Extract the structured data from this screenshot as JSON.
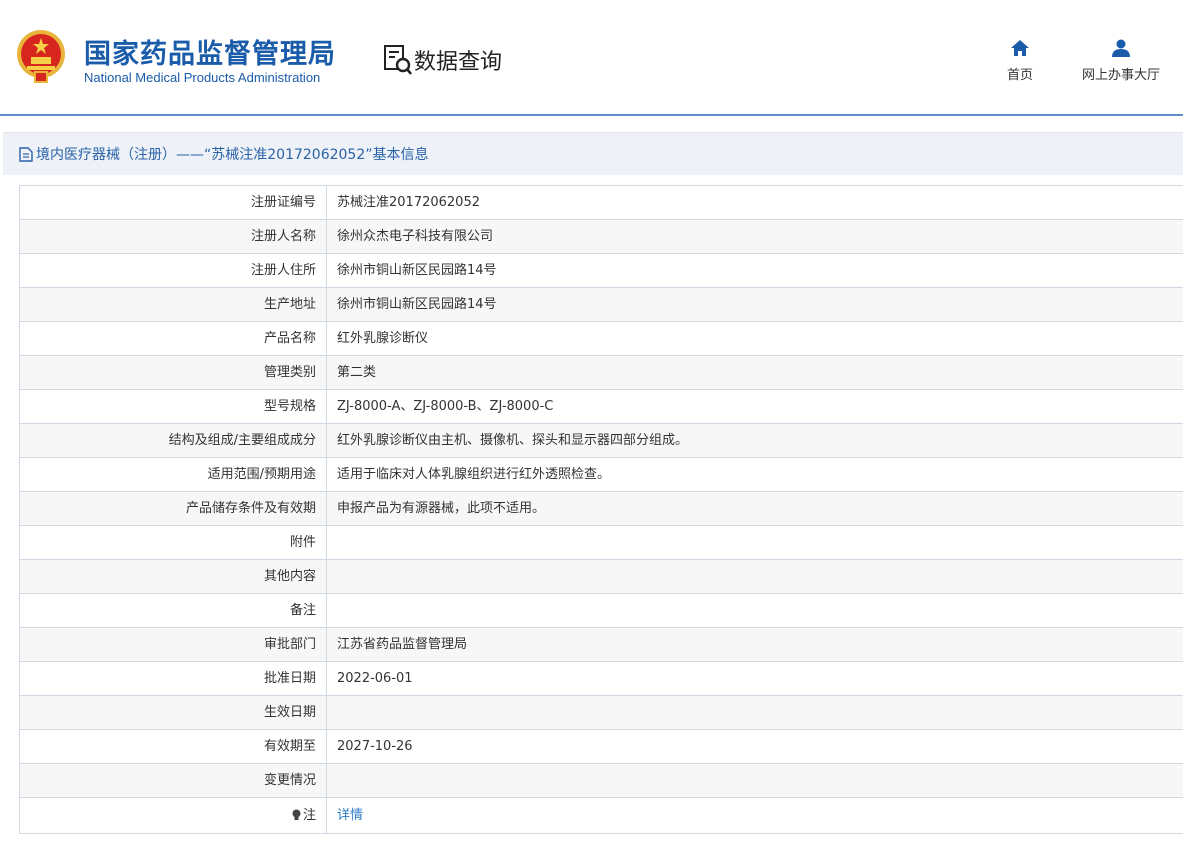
{
  "header": {
    "org_cn": "国家药品监督管理局",
    "org_en": "National Medical Products Administration",
    "section": "数据查询",
    "nav": [
      {
        "label": "首页",
        "icon": "home-icon"
      },
      {
        "label": "网上办事大厅",
        "icon": "user-icon"
      }
    ]
  },
  "panel": {
    "title": "境内医疗器械（注册）——“苏械注准20172062052”基本信息"
  },
  "rows": [
    {
      "key": "注册证编号",
      "value": "苏械注准20172062052"
    },
    {
      "key": "注册人名称",
      "value": "徐州众杰电子科技有限公司"
    },
    {
      "key": "注册人住所",
      "value": "徐州市铜山新区民园路14号"
    },
    {
      "key": "生产地址",
      "value": "徐州市铜山新区民园路14号"
    },
    {
      "key": "产品名称",
      "value": "红外乳腺诊断仪"
    },
    {
      "key": "管理类别",
      "value": "第二类"
    },
    {
      "key": "型号规格",
      "value": "ZJ-8000-A、ZJ-8000-B、ZJ-8000-C"
    },
    {
      "key": "结构及组成/主要组成成分",
      "value": "红外乳腺诊断仪由主机、摄像机、探头和显示器四部分组成。"
    },
    {
      "key": "适用范围/预期用途",
      "value": "适用于临床对人体乳腺组织进行红外透照检查。"
    },
    {
      "key": "产品储存条件及有效期",
      "value": "申报产品为有源器械，此项不适用。"
    },
    {
      "key": "附件",
      "value": ""
    },
    {
      "key": "其他内容",
      "value": ""
    },
    {
      "key": "备注",
      "value": ""
    },
    {
      "key": "审批部门",
      "value": "江苏省药品监督管理局"
    },
    {
      "key": "批准日期",
      "value": "2022-06-01"
    },
    {
      "key": "生效日期",
      "value": ""
    },
    {
      "key": "有效期至",
      "value": "2027-10-26"
    },
    {
      "key": "变更情况",
      "value": ""
    }
  ],
  "note": {
    "key": "注",
    "link": "详情"
  },
  "colors": {
    "brand": "#1a5caa",
    "link": "#2a7ac8",
    "title_bg": "#eef2f8"
  }
}
